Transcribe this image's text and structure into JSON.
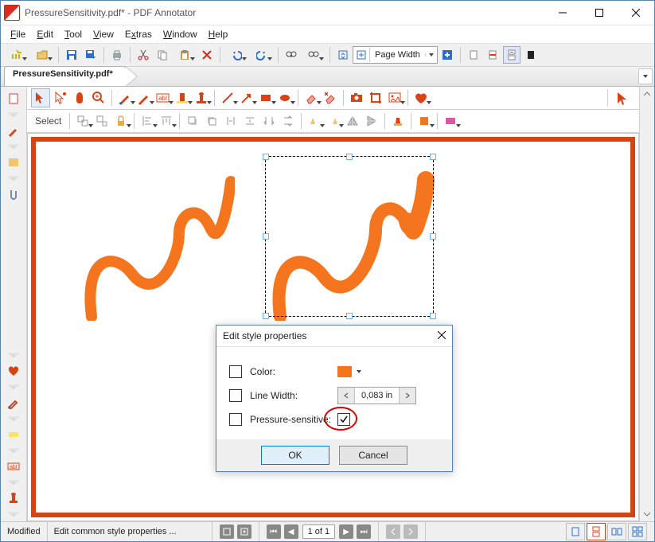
{
  "window": {
    "title": "PressureSensitivity.pdf* - PDF Annotator",
    "buttons": {
      "min": "Minimize",
      "max": "Maximize",
      "close": "Close"
    }
  },
  "menu": {
    "items": [
      "File",
      "Edit",
      "Tool",
      "View",
      "Extras",
      "Window",
      "Help"
    ]
  },
  "main_toolbar": {
    "zoom_label": "Page Width"
  },
  "tab": {
    "label": "PressureSensitivity.pdf*"
  },
  "toolbox": {
    "mode_label": "Select"
  },
  "dialog": {
    "title": "Edit style properties",
    "rows": {
      "color_label": "Color:",
      "linewidth_label": "Line Width:",
      "linewidth_value": "0,083 in",
      "pressure_label": "Pressure-sensitive:"
    },
    "buttons": {
      "ok": "OK",
      "cancel": "Cancel"
    },
    "pressure_checked": true,
    "color_value": "#f5751e"
  },
  "status": {
    "modified": "Modified",
    "hint": "Edit common style properties ...",
    "page_display": "1 of 1"
  },
  "icons": {
    "new": "new-file",
    "open": "folder-open",
    "save": "floppy",
    "saveas": "floppy-arrow",
    "print": "printer",
    "cut": "scissors",
    "copy": "copy",
    "paste": "paste",
    "delete": "x",
    "undo": "undo",
    "redo": "redo",
    "find": "binoculars",
    "doc_nav": "page-arrows",
    "zoom": "page-width",
    "plus": "plus",
    "layout1": "single-page",
    "layout2": "fit-page",
    "layout3": "two-page",
    "layout4": "dark-page"
  }
}
